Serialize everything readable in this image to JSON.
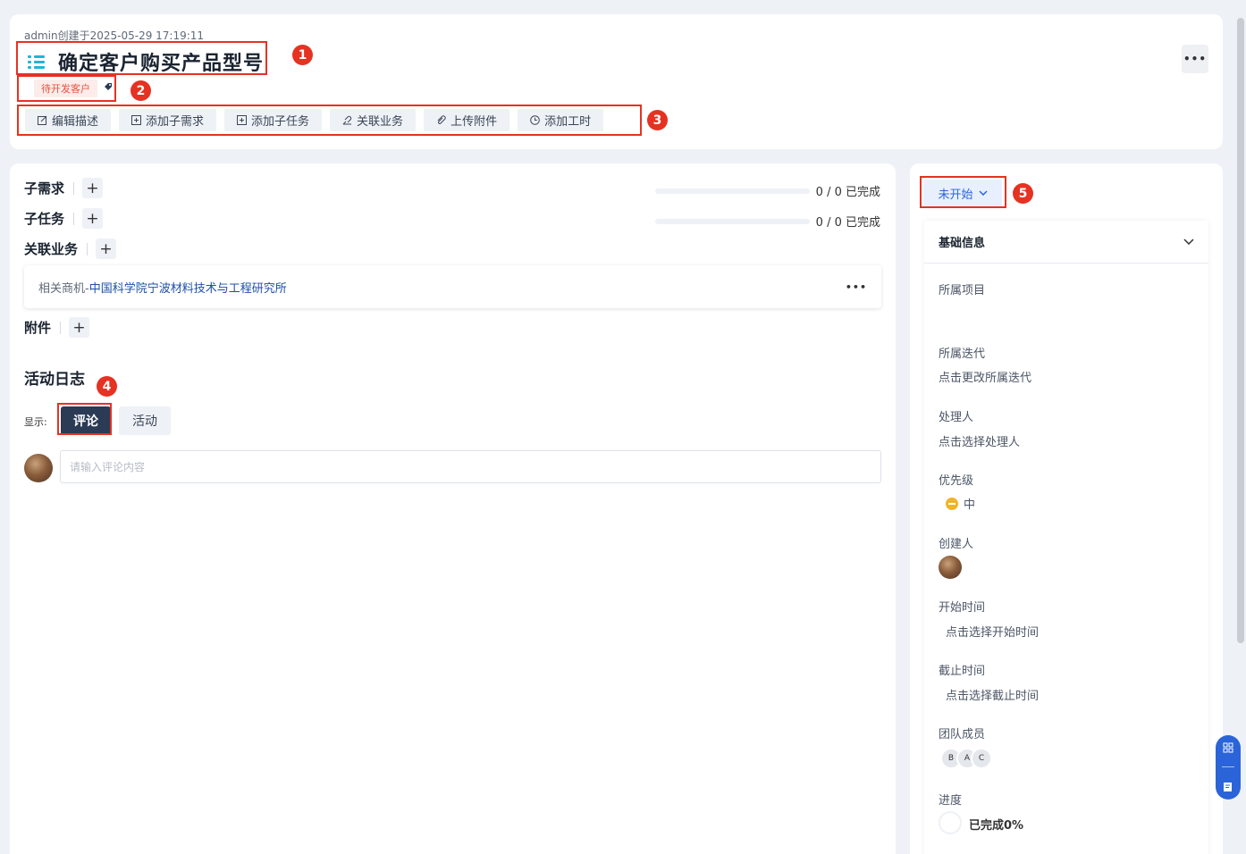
{
  "header": {
    "meta": "admin创建于2025-05-29 17:19:11",
    "title": "确定客户购买产品型号",
    "tag": "待开发客户",
    "more": "•••",
    "actions": [
      {
        "label": "编辑描述",
        "icon": "edit-icon"
      },
      {
        "label": "添加子需求",
        "icon": "plus-square-icon"
      },
      {
        "label": "添加子任务",
        "icon": "plus-square-icon"
      },
      {
        "label": "关联业务",
        "icon": "link-icon"
      },
      {
        "label": "上传附件",
        "icon": "paperclip-icon"
      },
      {
        "label": "添加工时",
        "icon": "clock-icon"
      }
    ]
  },
  "annotations": [
    "1",
    "2",
    "3",
    "4",
    "5"
  ],
  "main": {
    "sub_requirements": {
      "label": "子需求",
      "progress_text": "0 / 0 已完成",
      "progress": 0
    },
    "sub_tasks": {
      "label": "子任务",
      "progress_text": "0 / 0 已完成",
      "progress": 0
    },
    "related_business": {
      "label": "关联业务",
      "item_prefix": "相关商机-",
      "item_link": "中国科学院宁波材料技术与工程研究所",
      "item_more": "•••"
    },
    "attachments": {
      "label": "附件"
    },
    "plus": "+",
    "activity_log": {
      "title": "活动日志",
      "show_label": "显示:",
      "tabs": [
        "评论",
        "活动"
      ],
      "active_tab": "评论",
      "comment_placeholder": "请输入评论内容"
    }
  },
  "sidebar": {
    "status": "未开始",
    "section_title": "基础信息",
    "fields": {
      "project": {
        "label": "所属项目",
        "value": ""
      },
      "iteration": {
        "label": "所属迭代",
        "value": "点击更改所属迭代"
      },
      "assignee": {
        "label": "处理人",
        "value": "点击选择处理人"
      },
      "priority": {
        "label": "优先级",
        "value": "中"
      },
      "creator": {
        "label": "创建人"
      },
      "start_time": {
        "label": "开始时间",
        "value": "点击选择开始时间"
      },
      "deadline": {
        "label": "截止时间",
        "value": "点击选择截止时间"
      },
      "team": {
        "label": "团队成员",
        "members": [
          "B",
          "A",
          "C"
        ]
      },
      "progress": {
        "label": "进度",
        "value": "已完成0%",
        "percent": 0
      }
    }
  },
  "colors": {
    "accent": "#2a64d8",
    "annotation_red": "#e53222",
    "title_icon": "#1fb6d4",
    "tag_text": "#e5533d",
    "active_tab": "#2b3a55",
    "priority_medium": "#f0b429"
  }
}
